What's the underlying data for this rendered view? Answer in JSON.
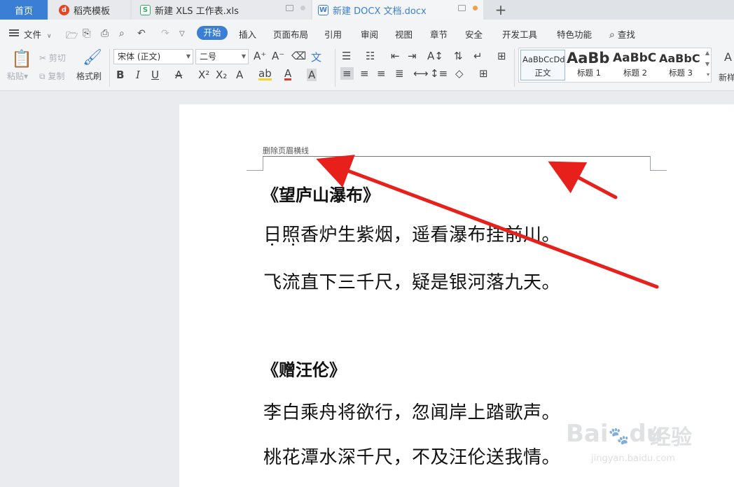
{
  "tabs": {
    "home": "首页",
    "daoke": "稻壳模板",
    "xls": "新建 XLS 工作表.xls",
    "docx": "新建 DOCX 文档.docx",
    "add": "+"
  },
  "menu": {
    "file": "文件",
    "items": [
      "开始",
      "插入",
      "页面布局",
      "引用",
      "审阅",
      "视图",
      "章节",
      "安全",
      "开发工具",
      "特色功能"
    ],
    "search": "查找"
  },
  "ribbon": {
    "paste": "粘贴",
    "cut": "剪切",
    "copy": "复制",
    "format_painter": "格式刷",
    "font_name": "宋体 (正文)",
    "font_size": "二号",
    "bold": "B",
    "italic": "I",
    "underline": "U",
    "styles": [
      {
        "preview": "AaBbCcDd",
        "label": "正文"
      },
      {
        "preview": "AaBb",
        "label": "标题 1"
      },
      {
        "preview": "AaBbC",
        "label": "标题 2"
      },
      {
        "preview": "AaBbC",
        "label": "标题 3"
      }
    ],
    "new_style": "新样"
  },
  "document": {
    "header_text": "删除页眉横线",
    "poem1_title": "《望庐山瀑布》",
    "poem1_line1": "日照香炉生紫烟，遥看瀑布挂前川。",
    "poem1_line2": "飞流直下三千尺，疑是银河落九天。",
    "poem2_title": "《赠汪伦》",
    "poem2_line1": "李白乘舟将欲行，忽闻岸上踏歌声。",
    "poem2_line2": "桃花潭水深千尺，不及汪伦送我情。"
  },
  "watermark": {
    "logo": "Bai",
    "logo2": "du",
    "cn": "经验",
    "url": "jingyan.baidu.com"
  },
  "colors": {
    "accent": "#3b7ed6",
    "arrow": "#e8201c"
  }
}
